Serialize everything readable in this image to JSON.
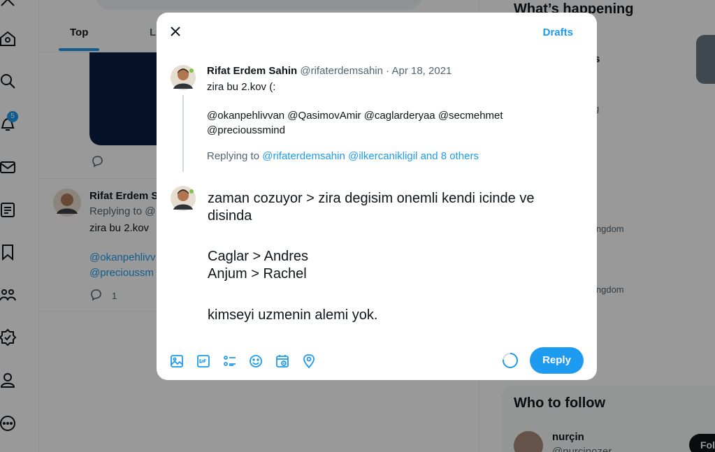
{
  "background": {
    "tabs": {
      "top": "Top",
      "latest": "L"
    },
    "notification_count": "5",
    "tweet": {
      "name": "Rifat Erdem S",
      "replying": "Replying to @",
      "text": "zira bu 2.kov",
      "mention_line1": "@okanpehlivv",
      "mention_line2": "@precioussm",
      "reply_count": "1"
    },
    "sidebar": {
      "whats_happening": "What’s happening",
      "trend_frag1": "s",
      "trend_frag2": "g",
      "trend_frag3": "ingdom",
      "trend_frag4": "ingdom",
      "who_to_follow": "Who to follow",
      "suggestion_name": "nurçin",
      "suggestion_handle": "@nurcinozer",
      "follow_label": "Fol"
    }
  },
  "modal": {
    "drafts_label": "Drafts",
    "original": {
      "name": "Rifat Erdem Sahin",
      "meta": "@rifaterdemsahin · Apr 18, 2021",
      "line1": "zira bu 2.kov (:",
      "line2": "@okanpehlivvan @QasimovAmir @caglarderyaa @secmehmet",
      "line3": "@precioussmind",
      "replying_prefix": "Replying to ",
      "replying_links": "@rifaterdemsahin @ilkercanikligil and 8 others"
    },
    "compose": {
      "line1": "zaman cozuyor > zira degisim onemli kendi icinde ve",
      "line2": "disinda",
      "line3": "Caglar  > Andres",
      "line4": "Anjum > Rachel",
      "line5": "kimseyi uzmenin alemi yok."
    },
    "toolbar_icons": [
      "image-icon",
      "gif-icon",
      "poll-icon",
      "emoji-icon",
      "schedule-icon",
      "location-icon"
    ],
    "reply_label": "Reply",
    "accent_color": "#1d9bf0"
  }
}
